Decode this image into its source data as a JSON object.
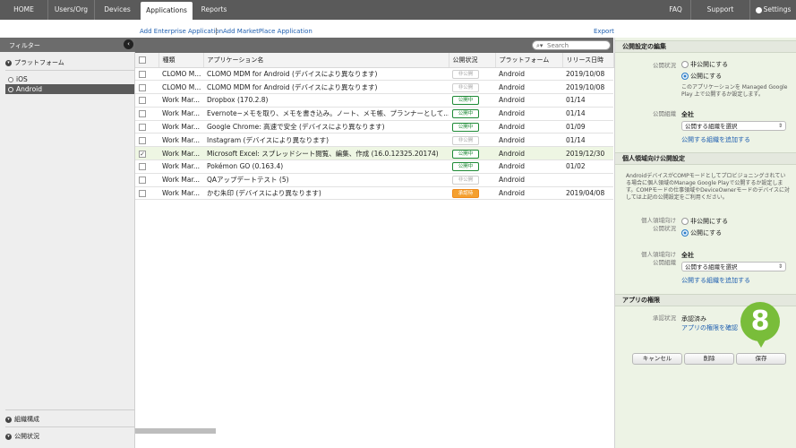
{
  "topnav": {
    "items": [
      {
        "label": "HOME"
      },
      {
        "label": "Users/Org"
      },
      {
        "label": "Devices"
      },
      {
        "label": "Applications"
      },
      {
        "label": "Reports"
      }
    ],
    "right": [
      {
        "label": "FAQ"
      },
      {
        "label": "Support"
      },
      {
        "label": "Settings"
      }
    ]
  },
  "actions": {
    "add_enterprise": "Add Enterprise Application",
    "separator": "|",
    "add_marketplace": "Add MarketPlace Application",
    "export": "Export"
  },
  "sidebar": {
    "title": "フィルター",
    "collapse_icon": "‹",
    "platform_label": "プラットフォーム",
    "platforms": [
      {
        "label": "iOS"
      },
      {
        "label": "Android"
      }
    ],
    "org_label": "組織構成",
    "status_label": "公開状況"
  },
  "table": {
    "search_placeholder": "Search",
    "headers": [
      "種類",
      "アプリケーション名",
      "公開状況",
      "プラットフォーム",
      "リリース日時"
    ],
    "rows": [
      {
        "checked": false,
        "type": "CLOMO M...",
        "name": "CLOMO MDM for Android (デバイスにより異なります)",
        "status": "非公開",
        "status_kind": "private",
        "platform": "Android",
        "date": "2019/10/08"
      },
      {
        "checked": false,
        "type": "CLOMO M...",
        "name": "CLOMO MDM for Android (デバイスにより異なります)",
        "status": "非公開",
        "status_kind": "private",
        "platform": "Android",
        "date": "2019/10/08"
      },
      {
        "checked": false,
        "type": "Work Mar...",
        "name": "Dropbox (170.2.8)",
        "status": "公開中",
        "status_kind": "public",
        "platform": "Android",
        "date": "01/14"
      },
      {
        "checked": false,
        "type": "Work Mar...",
        "name": "Evernote−メモを取り、メモを書き込み。ノート、メモ帳、プランナーとして...",
        "status": "公開中",
        "status_kind": "public",
        "platform": "Android",
        "date": "01/14"
      },
      {
        "checked": false,
        "type": "Work Mar...",
        "name": "Google Chrome: 高速で安全 (デバイスにより異なります)",
        "status": "公開中",
        "status_kind": "public",
        "platform": "Android",
        "date": "01/09"
      },
      {
        "checked": false,
        "type": "Work Mar...",
        "name": "Instagram (デバイスにより異なります)",
        "status": "非公開",
        "status_kind": "private",
        "platform": "Android",
        "date": "01/14"
      },
      {
        "checked": true,
        "type": "Work Mar...",
        "name": "Microsoft Excel: スプレッドシート閲覧、編集、作成 (16.0.12325.20174)",
        "status": "公開中",
        "status_kind": "public",
        "platform": "Android",
        "date": "2019/12/30"
      },
      {
        "checked": false,
        "type": "Work Mar...",
        "name": "Pokémon GO (0.163.4)",
        "status": "公開中",
        "status_kind": "public",
        "platform": "Android",
        "date": "01/02"
      },
      {
        "checked": false,
        "type": "Work Mar...",
        "name": "QAアップデートテスト (5)",
        "status": "非公開",
        "status_kind": "private",
        "platform": "Android",
        "date": ""
      },
      {
        "checked": false,
        "type": "Work Mar...",
        "name": "かむ朱印 (デバイスにより異なります)",
        "status": "承認待",
        "status_kind": "pending",
        "platform": "Android",
        "date": "2019/04/08"
      }
    ]
  },
  "panel": {
    "publish_head": "公開設定の編集",
    "status_label": "公開状況",
    "opt_private": "非公開にする",
    "opt_public": "公開にする",
    "managed_note": "このアプリケーションを Managed Google Play 上で公開するか設定します。",
    "org_label": "公開組織",
    "org_value": "全社",
    "org_select": "公開する組織を選択",
    "org_add": "公開する組織を追加する",
    "personal_head": "個人領域向け公開設定",
    "personal_note": "AndroidデバイスがCOMPモードとしてプロビジョニングされている場合に個人領域のManage Google Playで公開するか設定します。COMPモードの仕事領域やDeviceOwnerモードのデバイスに対しては上記の公開設定をご利用ください。",
    "personal_status_label_1": "個人領域向け",
    "personal_status_label_2": "公開状況",
    "personal_org_label_1": "個人領域向け",
    "personal_org_label_2": "公開組織",
    "permissions_head": "アプリの権限",
    "approval_label": "承認状況",
    "approval_value": "承認済み",
    "approval_link": "アプリの権限を確認",
    "btn_cancel": "キャンセル",
    "btn_delete": "削除",
    "btn_save": "保存"
  },
  "callout": {
    "number": "8",
    "color": "#79bd3a"
  }
}
